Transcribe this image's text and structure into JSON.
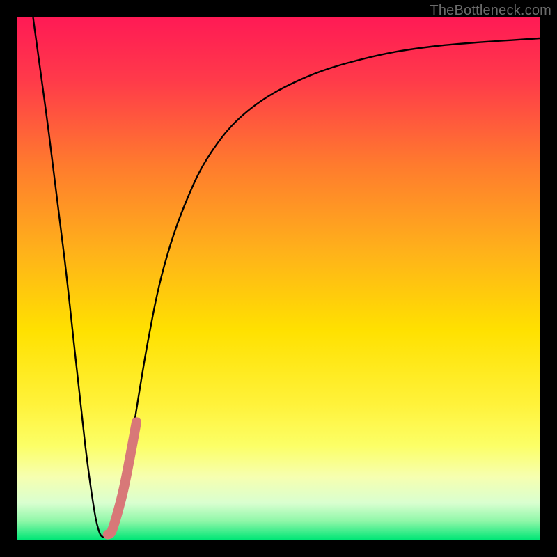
{
  "watermark": "TheBottleneck.com",
  "chart_data": {
    "type": "line",
    "title": "",
    "xlabel": "",
    "ylabel": "",
    "xlim": [
      0,
      100
    ],
    "ylim": [
      0,
      100
    ],
    "grid": false,
    "axis_visible": false,
    "background": {
      "type": "vertical-gradient",
      "stops": [
        {
          "offset": 0.0,
          "color": "#ff1a55"
        },
        {
          "offset": 0.12,
          "color": "#ff3a4a"
        },
        {
          "offset": 0.28,
          "color": "#ff7a2e"
        },
        {
          "offset": 0.45,
          "color": "#ffb21a"
        },
        {
          "offset": 0.6,
          "color": "#ffe100"
        },
        {
          "offset": 0.74,
          "color": "#fff23a"
        },
        {
          "offset": 0.82,
          "color": "#fcff66"
        },
        {
          "offset": 0.88,
          "color": "#f6ffb0"
        },
        {
          "offset": 0.93,
          "color": "#d9ffd0"
        },
        {
          "offset": 0.965,
          "color": "#8ef7a8"
        },
        {
          "offset": 1.0,
          "color": "#00e676"
        }
      ]
    },
    "series": [
      {
        "name": "curve",
        "stroke": "#000000",
        "stroke_width": 2.4,
        "fill": "none",
        "points": [
          {
            "x": 3.0,
            "y": 100.0
          },
          {
            "x": 6.0,
            "y": 78.0
          },
          {
            "x": 9.0,
            "y": 54.0
          },
          {
            "x": 11.0,
            "y": 36.0
          },
          {
            "x": 13.0,
            "y": 18.0
          },
          {
            "x": 14.5,
            "y": 7.0
          },
          {
            "x": 15.5,
            "y": 2.0
          },
          {
            "x": 16.5,
            "y": 0.5
          },
          {
            "x": 18.0,
            "y": 1.5
          },
          {
            "x": 20.0,
            "y": 8.0
          },
          {
            "x": 22.0,
            "y": 20.0
          },
          {
            "x": 25.0,
            "y": 38.0
          },
          {
            "x": 28.0,
            "y": 52.0
          },
          {
            "x": 32.0,
            "y": 64.0
          },
          {
            "x": 37.0,
            "y": 74.0
          },
          {
            "x": 44.0,
            "y": 82.0
          },
          {
            "x": 54.0,
            "y": 88.0
          },
          {
            "x": 66.0,
            "y": 92.0
          },
          {
            "x": 80.0,
            "y": 94.5
          },
          {
            "x": 100.0,
            "y": 96.0
          }
        ]
      },
      {
        "name": "highlight",
        "stroke": "#d87878",
        "stroke_width": 14,
        "stroke_linecap": "round",
        "fill": "none",
        "points": [
          {
            "x": 17.3,
            "y": 1.0
          },
          {
            "x": 18.0,
            "y": 1.5
          },
          {
            "x": 19.0,
            "y": 4.5
          },
          {
            "x": 20.3,
            "y": 9.5
          },
          {
            "x": 21.6,
            "y": 16.0
          },
          {
            "x": 22.8,
            "y": 22.5
          }
        ]
      }
    ]
  }
}
